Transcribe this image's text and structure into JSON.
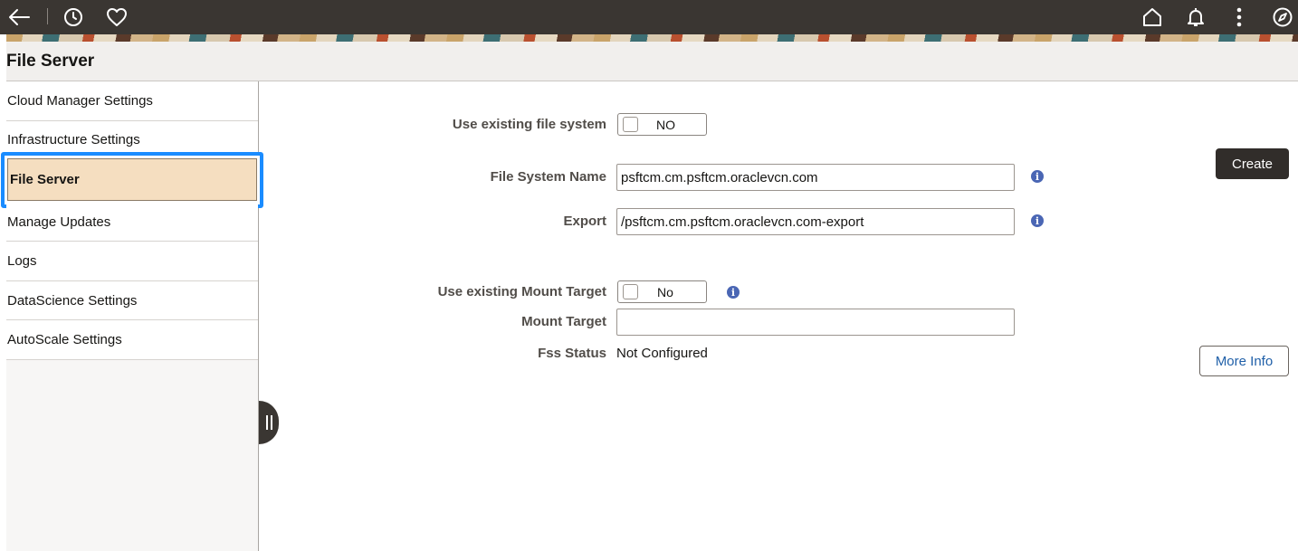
{
  "topbar": {
    "icons": [
      "back-arrow-icon",
      "history-icon",
      "favorites-heart-icon",
      "home-icon",
      "notifications-bell-icon",
      "more-options-icon",
      "navigator-compass-icon"
    ]
  },
  "page": {
    "title": "File Server"
  },
  "sidebar": {
    "items": [
      {
        "label": "Cloud Manager Settings"
      },
      {
        "label": "Infrastructure Settings"
      },
      {
        "label": "File Server",
        "active": true
      },
      {
        "label": "Manage Updates"
      },
      {
        "label": "Logs"
      },
      {
        "label": "DataScience Settings"
      },
      {
        "label": "AutoScale Settings"
      }
    ],
    "active_color": "#f5dec0",
    "focus_color": "#1a8cff"
  },
  "form": {
    "use_existing_fs": {
      "label": "Use existing file system",
      "value": "NO"
    },
    "fs_name": {
      "label": "File System Name",
      "value": "psftcm.cm.psftcm.oraclevcn.com"
    },
    "export": {
      "label": "Export",
      "value": "/psftcm.cm.psftcm.oraclevcn.com-export"
    },
    "use_existing_mt": {
      "label": "Use existing Mount Target",
      "value": "No"
    },
    "mount_target": {
      "label": "Mount Target",
      "value": ""
    },
    "fss_status": {
      "label": "Fss Status",
      "value": "Not Configured"
    }
  },
  "buttons": {
    "create": "Create",
    "more_info": "More Info"
  },
  "info_glyph": "i"
}
